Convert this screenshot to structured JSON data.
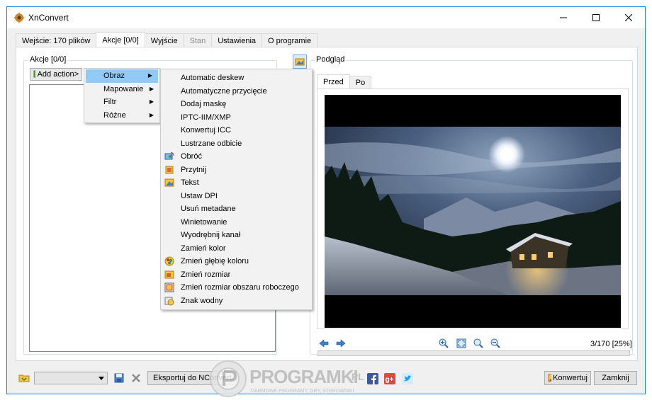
{
  "window": {
    "title": "XnConvert"
  },
  "tabs": [
    {
      "label": "Wejście: 170 plików",
      "state": "normal"
    },
    {
      "label": "Akcje [0/0]",
      "state": "active"
    },
    {
      "label": "Wyjście",
      "state": "normal"
    },
    {
      "label": "Stan",
      "state": "disabled"
    },
    {
      "label": "Ustawienia",
      "state": "normal"
    },
    {
      "label": "O programie",
      "state": "normal"
    }
  ],
  "actions": {
    "group_label": "Akcje [0/0]",
    "add_action_label": "Add action>"
  },
  "menu_categories": [
    {
      "label": "Obraz",
      "highlighted": true
    },
    {
      "label": "Mapowanie",
      "highlighted": false
    },
    {
      "label": "Filtr",
      "highlighted": false
    },
    {
      "label": "Różne",
      "highlighted": false
    }
  ],
  "menu_items": [
    {
      "label": "Automatic deskew",
      "icon": ""
    },
    {
      "label": "Automatyczne przycięcie",
      "icon": ""
    },
    {
      "label": "Dodaj maskę",
      "icon": ""
    },
    {
      "label": "IPTC-IIM/XMP",
      "icon": ""
    },
    {
      "label": "Konwertuj ICC",
      "icon": ""
    },
    {
      "label": "Lustrzane odbicie",
      "icon": ""
    },
    {
      "label": "Obróć",
      "icon": "rotate-icon"
    },
    {
      "label": "Przytnij",
      "icon": "crop-icon"
    },
    {
      "label": "Tekst",
      "icon": "text-icon"
    },
    {
      "label": "Ustaw DPI",
      "icon": ""
    },
    {
      "label": "Usuń metadane",
      "icon": ""
    },
    {
      "label": "Winietowanie",
      "icon": ""
    },
    {
      "label": "Wyodrębnij kanał",
      "icon": ""
    },
    {
      "label": "Zamień kolor",
      "icon": ""
    },
    {
      "label": "Zmień głębię koloru",
      "icon": "color-depth-icon"
    },
    {
      "label": "Zmień rozmiar",
      "icon": "resize-icon"
    },
    {
      "label": "Zmień rozmiar obszaru roboczego",
      "icon": "canvas-resize-icon"
    },
    {
      "label": "Znak wodny",
      "icon": "watermark-icon"
    }
  ],
  "preview": {
    "group_label": "Podgląd",
    "tab_before": "Przed",
    "tab_after": "Po",
    "counter": "3/170 [25%]"
  },
  "bottom": {
    "export_label": "Eksportuj do NConvert...",
    "convert_label": "Konwertuj",
    "close_label": "Zamknij",
    "social": [
      "facebook-icon",
      "google-plus-icon",
      "twitter-icon"
    ]
  },
  "watermark": {
    "brand": "PROGRAMKI",
    "tld": ".PL",
    "tagline": "DARMOWE PROGRAMY, GRY, STEROWNIKI"
  },
  "colors": {
    "accent": "#1883d7",
    "menu_highlight": "#91c9f7",
    "menu_bg": "#f2f2f2"
  }
}
